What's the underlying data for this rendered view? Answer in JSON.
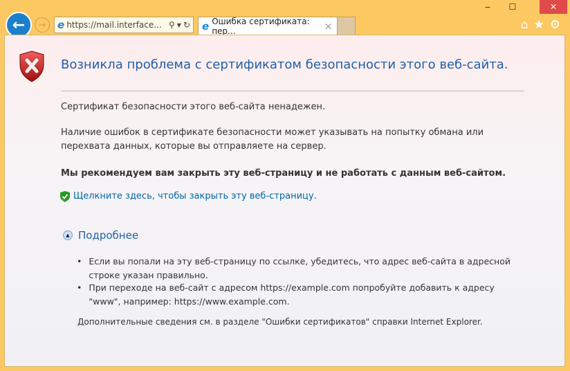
{
  "browser": {
    "address": "https://mail.interface...",
    "tab_title": "Ошибка сертификата: пер...",
    "tab_close": "×",
    "minimize": "‒",
    "maximize": "☐",
    "close": "✕"
  },
  "page": {
    "title": "Возникла проблема с сертификатом безопасности этого веб-сайта.",
    "p1": "Сертификат безопасности этого веб-сайта ненадежен.",
    "p2": "Наличие ошибок в сертификате безопасности может указывать на попытку обмана или перехвата данных, которые вы отправляете на сервер.",
    "recommend": "Мы рекомендуем вам закрыть эту веб-страницу и не работать с данным веб-сайтом.",
    "close_link": "Щелкните здесь, чтобы закрыть эту веб-страницу.",
    "more": "Подробнее",
    "bullets": [
      "Если вы попали на эту веб-страницу по ссылке, убедитесь, что адрес веб-сайта в адресной строке указан правильно.",
      "При переходе на веб-сайт с адресом https://example.com попробуйте добавить к адресу \"www\", например: https://www.example.com."
    ],
    "footer": "Дополнительные сведения см. в разделе \"Ошибки сертификатов\" справки Internet Explorer."
  }
}
